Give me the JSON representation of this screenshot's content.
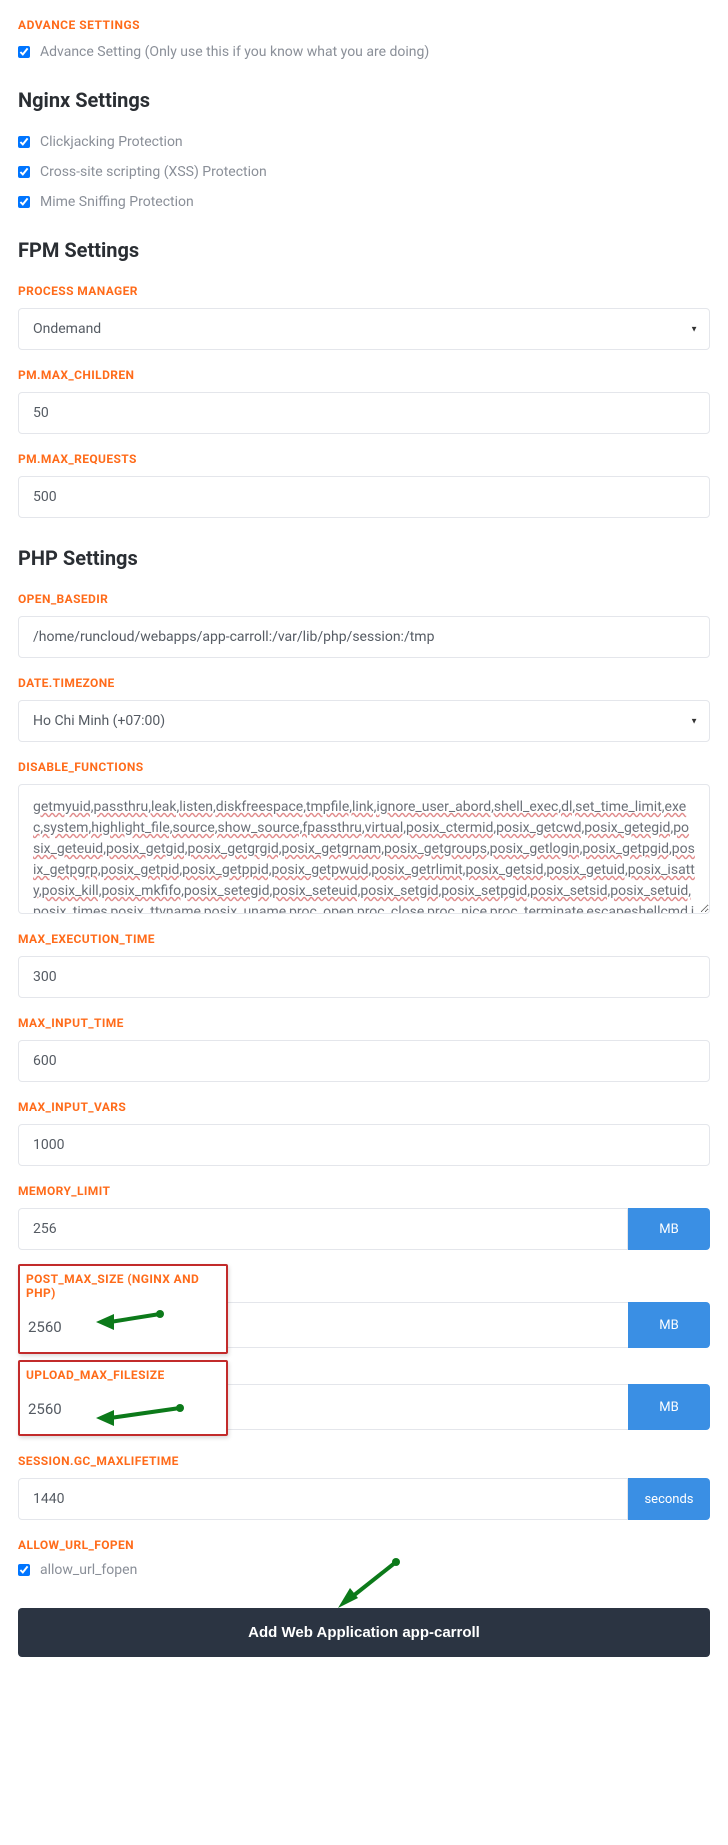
{
  "advance": {
    "heading": "ADVANCE SETTINGS",
    "checkbox_label": "Advance Setting (Only use this if you know what you are doing)"
  },
  "nginx": {
    "heading": "Nginx Settings",
    "clickjacking": "Clickjacking Protection",
    "xss": "Cross-site scripting (XSS) Protection",
    "mime": "Mime Sniffing Protection"
  },
  "fpm": {
    "heading": "FPM Settings",
    "process_manager_label": "PROCESS MANAGER",
    "process_manager_value": "Ondemand",
    "max_children_label": "PM.MAX_CHILDREN",
    "max_children_value": "50",
    "max_requests_label": "PM.MAX_REQUESTS",
    "max_requests_value": "500"
  },
  "php": {
    "heading": "PHP Settings",
    "open_basedir_label": "OPEN_BASEDIR",
    "open_basedir_value": "/home/runcloud/webapps/app-carroll:/var/lib/php/session:/tmp",
    "timezone_label": "DATE.TIMEZONE",
    "timezone_value": "Ho Chi Minh (+07:00)",
    "disable_functions_label": "DISABLE_FUNCTIONS",
    "disable_functions_value": "getmyuid,passthru,leak,listen,diskfreespace,tmpfile,link,ignore_user_abord,shell_exec,dl,set_time_limit,exec,system,highlight_file,source,show_source,fpassthru,virtual,posix_ctermid,posix_getcwd,posix_getegid,posix_geteuid,posix_getgid,posix_getgrgid,posix_getgrnam,posix_getgroups,posix_getlogin,posix_getpgid,posix_getpgrp,posix_getpid,posix_getppid,posix_getpwuid,posix_getrlimit,posix_getsid,posix_getuid,posix_isatty,posix_kill,posix_mkfifo,posix_setegid,posix_seteuid,posix_setgid,posix_setpgid,posix_setsid,posix_setuid,posix_times,posix_ttyname,posix_uname,proc_open,proc_close,proc_nice,proc_terminate,escapeshellcmd,ini_alter,popen,pcntl_exec,socket_accept,socket_bind,socket_clea",
    "max_exec_label": "MAX_EXECUTION_TIME",
    "max_exec_value": "300",
    "max_input_time_label": "MAX_INPUT_TIME",
    "max_input_time_value": "600",
    "max_input_vars_label": "MAX_INPUT_VARS",
    "max_input_vars_value": "1000",
    "memory_limit_label": "MEMORY_LIMIT",
    "memory_limit_value": "256",
    "post_max_label": "POST_MAX_SIZE (NGINX AND PHP)",
    "post_max_value": "2560",
    "upload_max_label": "UPLOAD_MAX_FILESIZE",
    "upload_max_value": "2560",
    "session_gc_label": "SESSION.GC_MAXLIFETIME",
    "session_gc_value": "1440",
    "allow_url_fopen_label": "ALLOW_URL_FOPEN",
    "allow_url_fopen_checkbox": "allow_url_fopen",
    "mb_suffix": "MB",
    "seconds_suffix": "seconds"
  },
  "submit": {
    "label": "Add Web Application app-carroll"
  }
}
